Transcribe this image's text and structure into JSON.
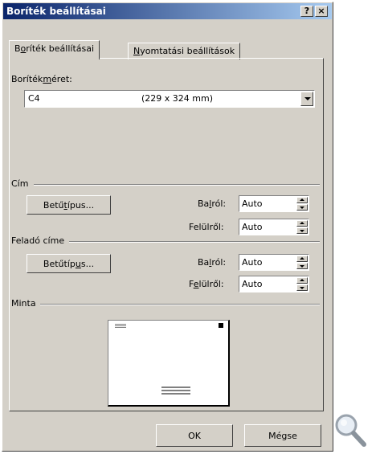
{
  "window": {
    "title": "Boríték beállításai",
    "help_button": "?",
    "close_button": "×"
  },
  "tabs": [
    {
      "label_pre": "B",
      "label_u": "o",
      "label_post": "ríték beállításai",
      "active": true
    },
    {
      "label_pre": "",
      "label_u": "N",
      "label_post": "yomtatási beállítások",
      "active": false
    }
  ],
  "envelope_size": {
    "label_pre": "Boríték",
    "label_u": "m",
    "label_post": "éret:",
    "value_name": "C4",
    "value_dims": "(229 x 324 mm)"
  },
  "address": {
    "group_label": "Cím",
    "font_button_pre": "Betű",
    "font_button_u": "t",
    "font_button_post": "ípus...",
    "left_label_pre": "Ba",
    "left_label_u": "l",
    "left_label_post": "ról:",
    "left_value": "Auto",
    "top_label": "Felülről:",
    "top_value": "Auto"
  },
  "return_address": {
    "group_label": "Feladó címe",
    "font_button_pre": "Betűtíp",
    "font_button_u": "u",
    "font_button_post": "s...",
    "left_label_pre": "Ba",
    "left_label_u": "l",
    "left_label_post": "ról:",
    "left_value": "Auto",
    "top_label_pre": "F",
    "top_label_u": "e",
    "top_label_post": "lülről:",
    "top_value": "Auto"
  },
  "preview": {
    "group_label": "Minta"
  },
  "buttons": {
    "ok": "OK",
    "cancel": "Mégse"
  },
  "icons": {
    "magnifier": "magnifier-icon"
  }
}
